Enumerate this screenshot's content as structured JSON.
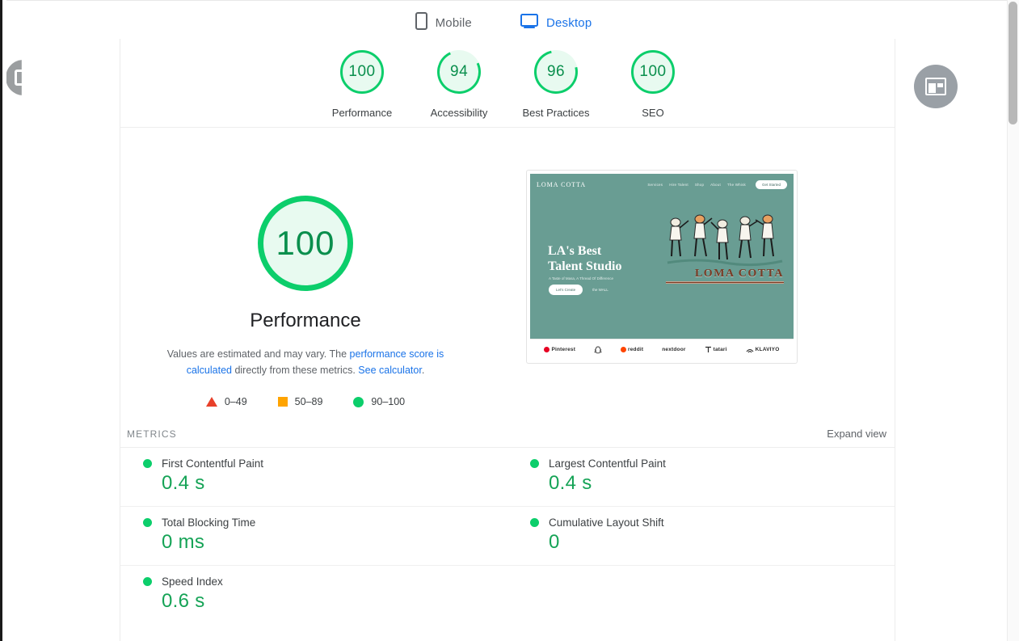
{
  "tabs": [
    {
      "label": "Mobile",
      "icon": "mobile-icon",
      "active": false
    },
    {
      "label": "Desktop",
      "icon": "desktop-icon",
      "active": true
    }
  ],
  "category_scores": [
    {
      "label": "Performance",
      "value": "100"
    },
    {
      "label": "Accessibility",
      "value": "94"
    },
    {
      "label": "Best Practices",
      "value": "96"
    },
    {
      "label": "SEO",
      "value": "100"
    }
  ],
  "hero": {
    "score": "100",
    "title": "Performance",
    "desc_prefix": "Values are estimated and may vary. The ",
    "desc_link1": "performance score is calculated",
    "desc_middle": " directly from these metrics. ",
    "desc_link2": "See calculator",
    "desc_suffix": "."
  },
  "legend": [
    {
      "shape": "triangle",
      "range": "0–49",
      "color": "#e8402a"
    },
    {
      "shape": "square",
      "range": "50–89",
      "color": "#ffa400"
    },
    {
      "shape": "circle",
      "range": "90–100",
      "color": "#0cce6b"
    }
  ],
  "metrics_section": {
    "title": "METRICS",
    "expand_label": "Expand view"
  },
  "metrics": [
    {
      "name": "First Contentful Paint",
      "value": "0.4 s",
      "status_color": "#0cce6b"
    },
    {
      "name": "Largest Contentful Paint",
      "value": "0.4 s",
      "status_color": "#0cce6b"
    },
    {
      "name": "Total Blocking Time",
      "value": "0 ms",
      "status_color": "#0cce6b"
    },
    {
      "name": "Cumulative Layout Shift",
      "value": "0",
      "status_color": "#0cce6b"
    },
    {
      "name": "Speed Index",
      "value": "0.6 s",
      "status_color": "#0cce6b"
    }
  ],
  "thumbnail": {
    "brand": "LOMA COTTA",
    "nav_links": [
      "Services",
      "Hire Talent",
      "Shop",
      "About",
      "The Whisk"
    ],
    "cta": "Get Started",
    "hero_line1": "LA's Best",
    "hero_line2": "Talent Studio",
    "hero_sub": "A Taste of Masa, A Thread Of Difference",
    "btn_primary": "Let's Create",
    "btn_secondary": "the WALL",
    "logo_text": "LOMA COTTA",
    "partners": [
      "Pinterest",
      "reddit",
      "nextdoor",
      "tatari",
      "KLAVIYO"
    ]
  },
  "colors": {
    "pass_green": "#0cce6b",
    "pass_green_text": "#15a356",
    "average_orange": "#ffa400",
    "fail_red": "#e8402a",
    "link_blue": "#1a73e8"
  }
}
